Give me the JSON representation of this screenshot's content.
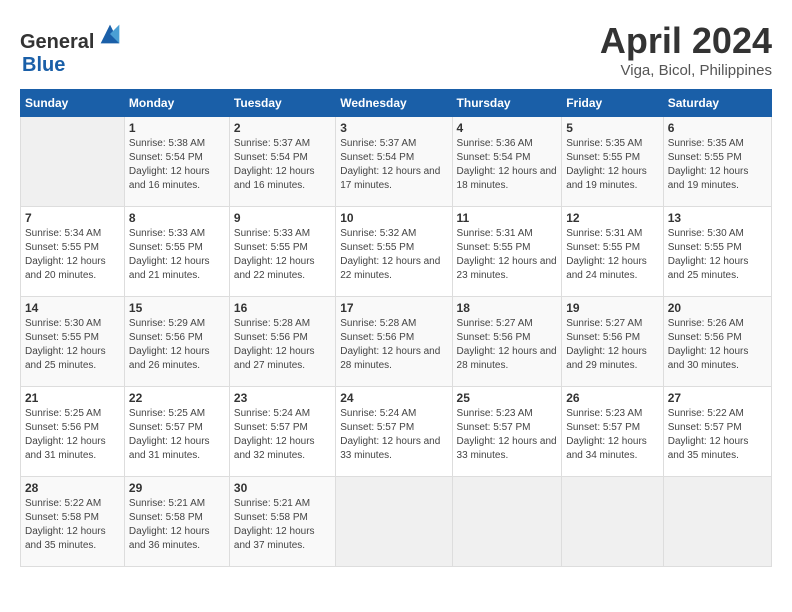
{
  "header": {
    "logo_general": "General",
    "logo_blue": "Blue",
    "month": "April 2024",
    "location": "Viga, Bicol, Philippines"
  },
  "days_of_week": [
    "Sunday",
    "Monday",
    "Tuesday",
    "Wednesday",
    "Thursday",
    "Friday",
    "Saturday"
  ],
  "weeks": [
    [
      {
        "day": "",
        "sunrise": "",
        "sunset": "",
        "daylight": ""
      },
      {
        "day": "1",
        "sunrise": "Sunrise: 5:38 AM",
        "sunset": "Sunset: 5:54 PM",
        "daylight": "Daylight: 12 hours and 16 minutes."
      },
      {
        "day": "2",
        "sunrise": "Sunrise: 5:37 AM",
        "sunset": "Sunset: 5:54 PM",
        "daylight": "Daylight: 12 hours and 16 minutes."
      },
      {
        "day": "3",
        "sunrise": "Sunrise: 5:37 AM",
        "sunset": "Sunset: 5:54 PM",
        "daylight": "Daylight: 12 hours and 17 minutes."
      },
      {
        "day": "4",
        "sunrise": "Sunrise: 5:36 AM",
        "sunset": "Sunset: 5:54 PM",
        "daylight": "Daylight: 12 hours and 18 minutes."
      },
      {
        "day": "5",
        "sunrise": "Sunrise: 5:35 AM",
        "sunset": "Sunset: 5:55 PM",
        "daylight": "Daylight: 12 hours and 19 minutes."
      },
      {
        "day": "6",
        "sunrise": "Sunrise: 5:35 AM",
        "sunset": "Sunset: 5:55 PM",
        "daylight": "Daylight: 12 hours and 19 minutes."
      }
    ],
    [
      {
        "day": "7",
        "sunrise": "Sunrise: 5:34 AM",
        "sunset": "Sunset: 5:55 PM",
        "daylight": "Daylight: 12 hours and 20 minutes."
      },
      {
        "day": "8",
        "sunrise": "Sunrise: 5:33 AM",
        "sunset": "Sunset: 5:55 PM",
        "daylight": "Daylight: 12 hours and 21 minutes."
      },
      {
        "day": "9",
        "sunrise": "Sunrise: 5:33 AM",
        "sunset": "Sunset: 5:55 PM",
        "daylight": "Daylight: 12 hours and 22 minutes."
      },
      {
        "day": "10",
        "sunrise": "Sunrise: 5:32 AM",
        "sunset": "Sunset: 5:55 PM",
        "daylight": "Daylight: 12 hours and 22 minutes."
      },
      {
        "day": "11",
        "sunrise": "Sunrise: 5:31 AM",
        "sunset": "Sunset: 5:55 PM",
        "daylight": "Daylight: 12 hours and 23 minutes."
      },
      {
        "day": "12",
        "sunrise": "Sunrise: 5:31 AM",
        "sunset": "Sunset: 5:55 PM",
        "daylight": "Daylight: 12 hours and 24 minutes."
      },
      {
        "day": "13",
        "sunrise": "Sunrise: 5:30 AM",
        "sunset": "Sunset: 5:55 PM",
        "daylight": "Daylight: 12 hours and 25 minutes."
      }
    ],
    [
      {
        "day": "14",
        "sunrise": "Sunrise: 5:30 AM",
        "sunset": "Sunset: 5:55 PM",
        "daylight": "Daylight: 12 hours and 25 minutes."
      },
      {
        "day": "15",
        "sunrise": "Sunrise: 5:29 AM",
        "sunset": "Sunset: 5:56 PM",
        "daylight": "Daylight: 12 hours and 26 minutes."
      },
      {
        "day": "16",
        "sunrise": "Sunrise: 5:28 AM",
        "sunset": "Sunset: 5:56 PM",
        "daylight": "Daylight: 12 hours and 27 minutes."
      },
      {
        "day": "17",
        "sunrise": "Sunrise: 5:28 AM",
        "sunset": "Sunset: 5:56 PM",
        "daylight": "Daylight: 12 hours and 28 minutes."
      },
      {
        "day": "18",
        "sunrise": "Sunrise: 5:27 AM",
        "sunset": "Sunset: 5:56 PM",
        "daylight": "Daylight: 12 hours and 28 minutes."
      },
      {
        "day": "19",
        "sunrise": "Sunrise: 5:27 AM",
        "sunset": "Sunset: 5:56 PM",
        "daylight": "Daylight: 12 hours and 29 minutes."
      },
      {
        "day": "20",
        "sunrise": "Sunrise: 5:26 AM",
        "sunset": "Sunset: 5:56 PM",
        "daylight": "Daylight: 12 hours and 30 minutes."
      }
    ],
    [
      {
        "day": "21",
        "sunrise": "Sunrise: 5:25 AM",
        "sunset": "Sunset: 5:56 PM",
        "daylight": "Daylight: 12 hours and 31 minutes."
      },
      {
        "day": "22",
        "sunrise": "Sunrise: 5:25 AM",
        "sunset": "Sunset: 5:57 PM",
        "daylight": "Daylight: 12 hours and 31 minutes."
      },
      {
        "day": "23",
        "sunrise": "Sunrise: 5:24 AM",
        "sunset": "Sunset: 5:57 PM",
        "daylight": "Daylight: 12 hours and 32 minutes."
      },
      {
        "day": "24",
        "sunrise": "Sunrise: 5:24 AM",
        "sunset": "Sunset: 5:57 PM",
        "daylight": "Daylight: 12 hours and 33 minutes."
      },
      {
        "day": "25",
        "sunrise": "Sunrise: 5:23 AM",
        "sunset": "Sunset: 5:57 PM",
        "daylight": "Daylight: 12 hours and 33 minutes."
      },
      {
        "day": "26",
        "sunrise": "Sunrise: 5:23 AM",
        "sunset": "Sunset: 5:57 PM",
        "daylight": "Daylight: 12 hours and 34 minutes."
      },
      {
        "day": "27",
        "sunrise": "Sunrise: 5:22 AM",
        "sunset": "Sunset: 5:57 PM",
        "daylight": "Daylight: 12 hours and 35 minutes."
      }
    ],
    [
      {
        "day": "28",
        "sunrise": "Sunrise: 5:22 AM",
        "sunset": "Sunset: 5:58 PM",
        "daylight": "Daylight: 12 hours and 35 minutes."
      },
      {
        "day": "29",
        "sunrise": "Sunrise: 5:21 AM",
        "sunset": "Sunset: 5:58 PM",
        "daylight": "Daylight: 12 hours and 36 minutes."
      },
      {
        "day": "30",
        "sunrise": "Sunrise: 5:21 AM",
        "sunset": "Sunset: 5:58 PM",
        "daylight": "Daylight: 12 hours and 37 minutes."
      },
      {
        "day": "",
        "sunrise": "",
        "sunset": "",
        "daylight": ""
      },
      {
        "day": "",
        "sunrise": "",
        "sunset": "",
        "daylight": ""
      },
      {
        "day": "",
        "sunrise": "",
        "sunset": "",
        "daylight": ""
      },
      {
        "day": "",
        "sunrise": "",
        "sunset": "",
        "daylight": ""
      }
    ]
  ]
}
